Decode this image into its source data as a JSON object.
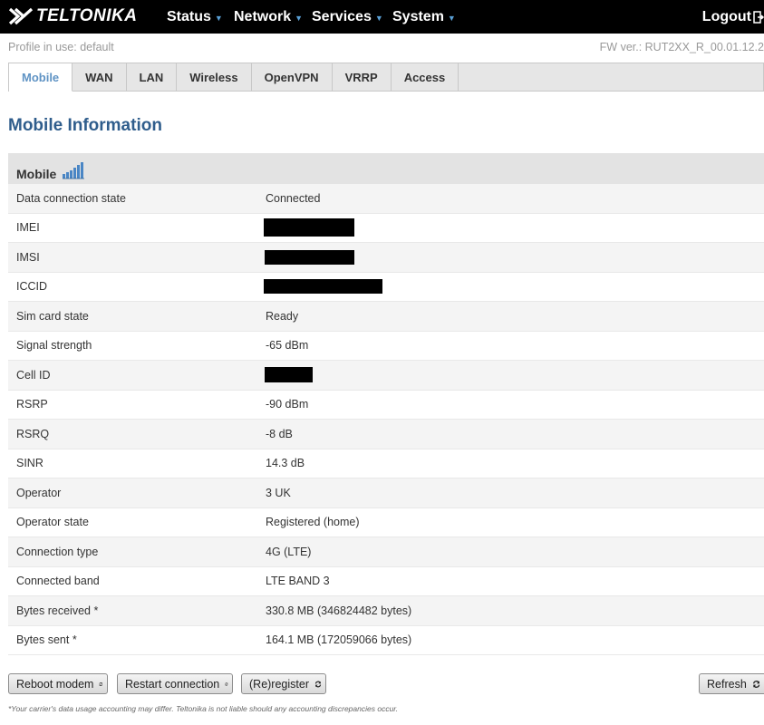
{
  "header": {
    "logo_text": "TELTONIKA",
    "nav": [
      {
        "label": "Status"
      },
      {
        "label": "Network"
      },
      {
        "label": "Services"
      },
      {
        "label": "System"
      }
    ],
    "logout_label": "Logout"
  },
  "info": {
    "profile": "Profile in use: default",
    "fw": "FW ver.: RUT2XX_R_00.01.12.2"
  },
  "tabs": [
    {
      "label": "Mobile",
      "active": true
    },
    {
      "label": "WAN"
    },
    {
      "label": "LAN"
    },
    {
      "label": "Wireless"
    },
    {
      "label": "OpenVPN"
    },
    {
      "label": "VRRP"
    },
    {
      "label": "Access"
    }
  ],
  "page_title": "Mobile Information",
  "section": {
    "title": "Mobile",
    "icon": "signal-strength-icon"
  },
  "rows": [
    {
      "label": "Data connection state",
      "value": "Connected"
    },
    {
      "label": "IMEI",
      "value": ""
    },
    {
      "label": "IMSI",
      "value": ""
    },
    {
      "label": "ICCID",
      "value": ""
    },
    {
      "label": "Sim card state",
      "value": "Ready"
    },
    {
      "label": "Signal strength",
      "value": "-65 dBm"
    },
    {
      "label": "Cell ID",
      "value": ""
    },
    {
      "label": "RSRP",
      "value": "-90 dBm"
    },
    {
      "label": "RSRQ",
      "value": "-8 dB"
    },
    {
      "label": "SINR",
      "value": "14.3 dB"
    },
    {
      "label": "Operator",
      "value": "3 UK"
    },
    {
      "label": "Operator state",
      "value": "Registered (home)"
    },
    {
      "label": "Connection type",
      "value": "4G (LTE)"
    },
    {
      "label": "Connected band",
      "value": "LTE BAND 3"
    },
    {
      "label": "Bytes received *",
      "value": "330.8 MB (346824482 bytes)"
    },
    {
      "label": "Bytes sent *",
      "value": "164.1 MB (172059066 bytes)"
    }
  ],
  "buttons": {
    "reboot": "Reboot modem",
    "restart": "Restart connection",
    "reregister": "(Re)register",
    "refresh": "Refresh"
  },
  "footnote": "*Your carrier's data usage accounting may differ. Teltonika is not liable should any accounting discrepancies occur.",
  "colors": {
    "topbar": "#000000",
    "title": "#2f5d8c",
    "active_tab": "#5f93c4",
    "caret": "#5aa0d6"
  }
}
